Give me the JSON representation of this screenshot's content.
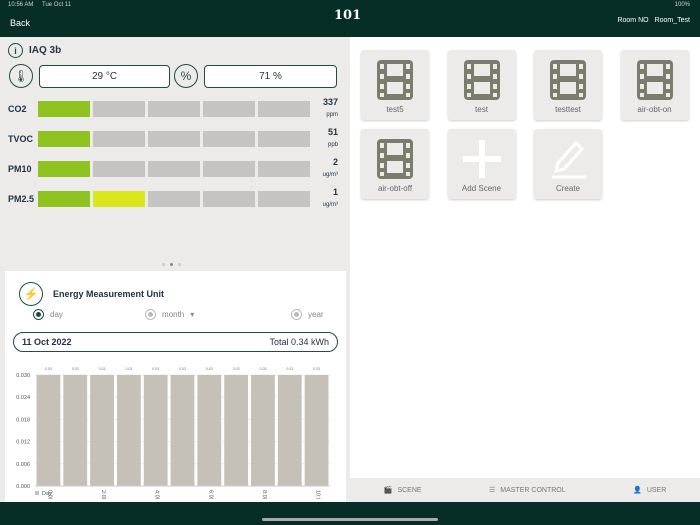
{
  "status": {
    "time": "10:56 AM",
    "date": "Tue Oct 11",
    "battery": "100%"
  },
  "header": {
    "back": "Back",
    "logo": "101",
    "room_no": "Room NO",
    "room_name": "Room_Test"
  },
  "iaq": {
    "title": "IAQ 3b",
    "temperature": "29 °C",
    "humidity": "71 %",
    "rows": [
      {
        "label": "CO2",
        "value": "337",
        "unit": "ppm",
        "level": 1,
        "colors": [
          "#8fc31f"
        ]
      },
      {
        "label": "TVOC",
        "value": "51",
        "unit": "ppb",
        "level": 1,
        "colors": [
          "#8fc31f"
        ]
      },
      {
        "label": "PM10",
        "value": "2",
        "unit": "ug/m³",
        "level": 1,
        "colors": [
          "#8fc31f"
        ]
      },
      {
        "label": "PM2.5",
        "value": "1",
        "unit": "ug/m³",
        "level": 2,
        "colors": [
          "#8fc31f",
          "#d8e81a"
        ]
      }
    ]
  },
  "energy": {
    "title": "Energy Measurement Unit",
    "options": [
      "day",
      "month",
      "year"
    ],
    "selected": "day",
    "date": "11 Oct 2022",
    "total": "Total  0.34  kWh"
  },
  "chart_data": {
    "type": "bar",
    "categories": [
      "0:00",
      "1:00",
      "2:00",
      "3:00",
      "4:00",
      "5:00",
      "6:00",
      "7:00",
      "8:00",
      "9:00",
      "10:00"
    ],
    "tick_labels": [
      "0:00",
      "",
      "2:00",
      "",
      "4:00",
      "",
      "6:00",
      "",
      "8:00",
      "",
      "10:00"
    ],
    "values": [
      0.03,
      0.03,
      0.03,
      0.03,
      0.03,
      0.03,
      0.03,
      0.03,
      0.03,
      0.03,
      0.03
    ],
    "data_labels": [
      "0.03",
      "0.03",
      "0.03",
      "0.03",
      "0.03",
      "0.03",
      "0.03",
      "0.03",
      "0.03",
      "0.03",
      "0.03"
    ],
    "yticks": [
      "0.030",
      "0.024",
      "0.018",
      "0.012",
      "0.006",
      "0.000"
    ],
    "ylim": [
      0,
      0.03
    ],
    "legend": "Day",
    "color": "#c5c1b9"
  },
  "scenes": [
    {
      "label": "test5",
      "icon": "film"
    },
    {
      "label": "test",
      "icon": "film"
    },
    {
      "label": "testtest",
      "icon": "film"
    },
    {
      "label": "air-obt-on",
      "icon": "film"
    },
    {
      "label": "air-obt-off",
      "icon": "film"
    },
    {
      "label": "Add Scene",
      "icon": "plus"
    },
    {
      "label": "Create",
      "icon": "pencil"
    }
  ],
  "tabs": [
    {
      "label": "SCENE"
    },
    {
      "label": "MASTER CONTROL"
    },
    {
      "label": "USER"
    }
  ]
}
